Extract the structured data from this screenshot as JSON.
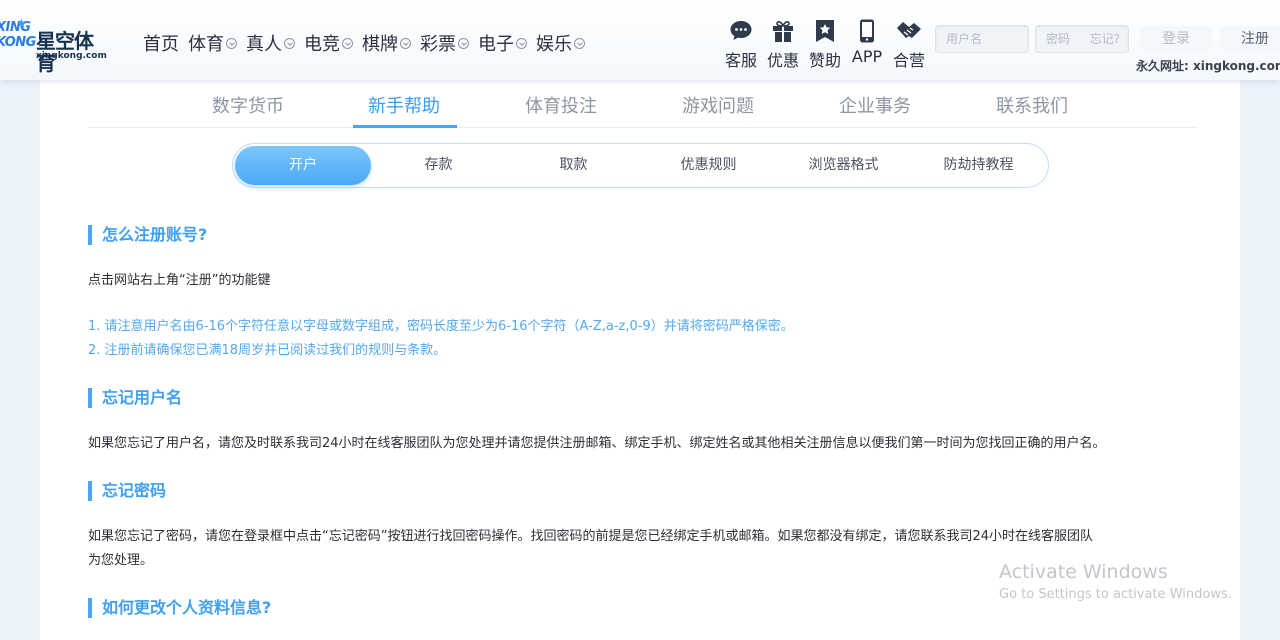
{
  "header": {
    "logo": {
      "mark_line1": "XING",
      "mark_line2": "KONG",
      "name_cn": "星空体育",
      "name_en": "xingkong.com"
    },
    "nav": [
      {
        "label": "首页",
        "dropdown": false
      },
      {
        "label": "体育",
        "dropdown": true
      },
      {
        "label": "真人",
        "dropdown": true
      },
      {
        "label": "电竞",
        "dropdown": true
      },
      {
        "label": "棋牌",
        "dropdown": true
      },
      {
        "label": "彩票",
        "dropdown": true
      },
      {
        "label": "电子",
        "dropdown": true
      },
      {
        "label": "娱乐",
        "dropdown": true
      }
    ],
    "quick_links": [
      {
        "label": "客服",
        "icon": "chat-icon"
      },
      {
        "label": "优惠",
        "icon": "gift-icon"
      },
      {
        "label": "赞助",
        "icon": "bookmark-star-icon"
      },
      {
        "label": "APP",
        "icon": "phone-icon"
      },
      {
        "label": "合营",
        "icon": "handshake-icon"
      }
    ],
    "username_placeholder": "用户名",
    "password_placeholder": "密码",
    "forgot_label": "忘记?",
    "login_label": "登录",
    "register_label": "注册",
    "permanent_url": "永久网址: xingkong.com"
  },
  "help_tabs": [
    {
      "label": "数字货币"
    },
    {
      "label": "新手帮助",
      "active": true
    },
    {
      "label": "体育投注"
    },
    {
      "label": "游戏问题"
    },
    {
      "label": "企业事务"
    },
    {
      "label": "联系我们"
    }
  ],
  "sub_tabs": [
    {
      "label": "开户",
      "active": true
    },
    {
      "label": "存款"
    },
    {
      "label": "取款"
    },
    {
      "label": "优惠规则"
    },
    {
      "label": "浏览器格式"
    },
    {
      "label": "防劫持教程"
    }
  ],
  "content": {
    "s1_title": "怎么注册账号?",
    "s1_text": "点击网站右上角“注册”的功能键",
    "s1_note1": "1. 请注意用户名由6-16个字符任意以字母或数字组成，密码长度至少为6-16个字符（A-Z,a-z,0-9）并请将密码严格保密。",
    "s1_note2": "2. 注册前请确保您已满18周岁并已阅读过我们的规则与条款。",
    "s2_title": "忘记用户名",
    "s2_text": "如果您忘记了用户名，请您及时联系我司24小时在线客服团队为您处理并请您提供注册邮箱、绑定手机、绑定姓名或其他相关注册信息以便我们第一时间为您找回正确的用户名。",
    "s3_title": "忘记密码",
    "s3_text_line1": "如果您忘记了密码，请您在登录框中点击“忘记密码”按钮进行找回密码操作。找回密码的前提是您已经绑定手机或邮箱。如果您都没有绑定，请您联系我司24小时在线客服团队",
    "s3_text_line2": "为您处理。",
    "s4_title": "如何更改个人资料信息?"
  },
  "watermark": {
    "line1": "Activate Windows",
    "line2": "Go to Settings to activate Windows."
  },
  "colors": {
    "accent": "#4aa5f5",
    "note_text": "#54a8ec",
    "body_text": "#2c2f36"
  }
}
